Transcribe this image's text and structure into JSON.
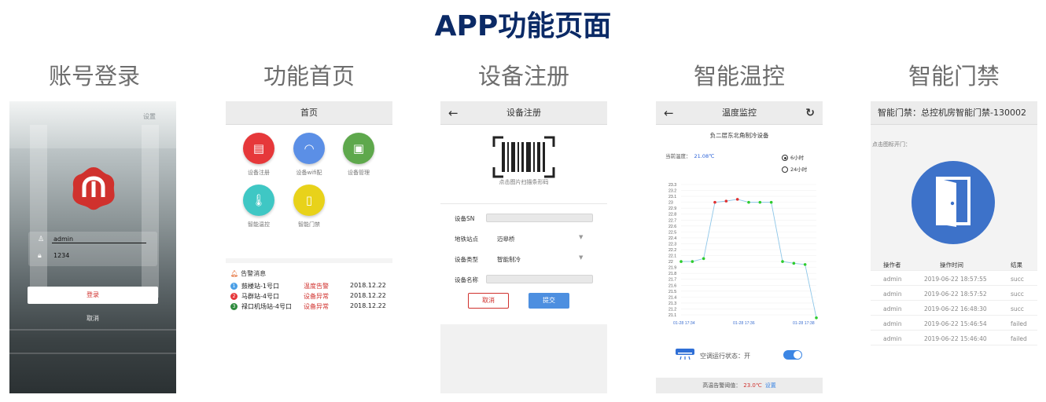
{
  "page": {
    "title": "APP功能页面"
  },
  "columns": [
    "账号登录",
    "功能首页",
    "设备注册",
    "智能温控",
    "智能门禁"
  ],
  "login": {
    "settings": "设置",
    "username": "admin",
    "password": "1234",
    "login_button": "登录",
    "cancel": "取消",
    "brand_color": "#d0312d"
  },
  "home": {
    "title": "首页",
    "functions": [
      {
        "label": "设备注册",
        "icon": "register-icon",
        "color": "#e6383a"
      },
      {
        "label": "设备wifi配",
        "icon": "wifi-icon",
        "color": "#5b8fe6"
      },
      {
        "label": "设备管理",
        "icon": "device-manage-icon",
        "color": "#5ea84c"
      },
      {
        "label": "智能温控",
        "icon": "thermometer-icon",
        "color": "#3fc7c4"
      },
      {
        "label": "智能门禁",
        "icon": "door-access-icon",
        "color": "#e8d21a"
      }
    ],
    "alerts_title": "告警消息",
    "alerts": [
      {
        "num": "1",
        "station": "鼓楼站-1号口",
        "type": "温度告警",
        "date": "2018.12.22",
        "color": "#4a9fe6"
      },
      {
        "num": "2",
        "station": "马群站-4号口",
        "type": "设备异常",
        "date": "2018.12.22",
        "color": "#e6383a"
      },
      {
        "num": "3",
        "station": "禄口机场站-4号口",
        "type": "设备异常",
        "date": "2018.12.22",
        "color": "#2e8b3d"
      }
    ]
  },
  "register": {
    "title": "设备注册",
    "scan_label": "点击图片扫描条形码",
    "fields": [
      {
        "label": "设备SN",
        "value": ""
      },
      {
        "label": "地铁站点",
        "value": "迈皋桥"
      },
      {
        "label": "设备类型",
        "value": "智能制冷"
      },
      {
        "label": "设备名称",
        "value": ""
      }
    ],
    "cancel": "取消",
    "submit": "提交"
  },
  "temperature": {
    "title": "温度监控",
    "subtitle": "负二层东北角制冷设备",
    "current_label": "当前温度：",
    "current_value": "21.08℃",
    "range_options": [
      "6小时",
      "24小时"
    ],
    "selected_range": "6小时",
    "ac_status": "空调运行状态：开",
    "ac_on": true,
    "threshold_label": "高温告警阈值：",
    "threshold_value": "23.0℃",
    "settings": "设置"
  },
  "chart_data": {
    "type": "line",
    "x": [
      "01-28 17:34",
      "01-28 17:34",
      "01-28 17:34",
      "01-28 17:35",
      "01-28 17:35",
      "01-28 17:35",
      "01-28 17:36",
      "01-28 17:36",
      "01-28 17:36",
      "01-28 17:37",
      "01-28 17:37",
      "01-28 17:37",
      "01-28 17:38"
    ],
    "values": [
      22.0,
      22.0,
      22.05,
      23.0,
      23.02,
      23.05,
      23.0,
      23.0,
      23.0,
      22.0,
      21.97,
      21.95,
      21.05
    ],
    "point_colors": [
      "#2ecc2e",
      "#2ecc2e",
      "#2ecc2e",
      "#e03030",
      "#e03030",
      "#e03030",
      "#2ecc2e",
      "#2ecc2e",
      "#2ecc2e",
      "#2ecc2e",
      "#2ecc2e",
      "#2ecc2e",
      "#2ecc2e"
    ],
    "ylim": [
      21.1,
      23.3
    ],
    "ytick_labels": [
      "23.3",
      "23.2",
      "23.1",
      "23",
      "22.9",
      "22.8",
      "22.7",
      "22.6",
      "22.5",
      "22.4",
      "22.3",
      "22.2",
      "22.1",
      "22",
      "21.9",
      "21.8",
      "21.7",
      "21.6",
      "21.5",
      "21.4",
      "21.3",
      "21.2",
      "21.1"
    ],
    "xtick_labels": [
      "01-28 17:34",
      "01-28 17:36",
      "01-28 17:38"
    ],
    "line_color": "#8ec6e8",
    "grid": true
  },
  "door": {
    "title": "智能门禁：总控机房智能门禁-130002",
    "hint": "点击图标开门：",
    "columns": [
      "操作者",
      "操作时间",
      "结果"
    ],
    "rows": [
      {
        "user": "admin",
        "time": "2019-06-22 18:57:55",
        "result": "succ"
      },
      {
        "user": "admin",
        "time": "2019-06-22 18:57:52",
        "result": "succ"
      },
      {
        "user": "admin",
        "time": "2019-06-22 16:48:30",
        "result": "succ"
      },
      {
        "user": "admin",
        "time": "2019-06-22 15:46:54",
        "result": "failed"
      },
      {
        "user": "admin",
        "time": "2019-06-22 15:46:40",
        "result": "failed"
      }
    ]
  }
}
